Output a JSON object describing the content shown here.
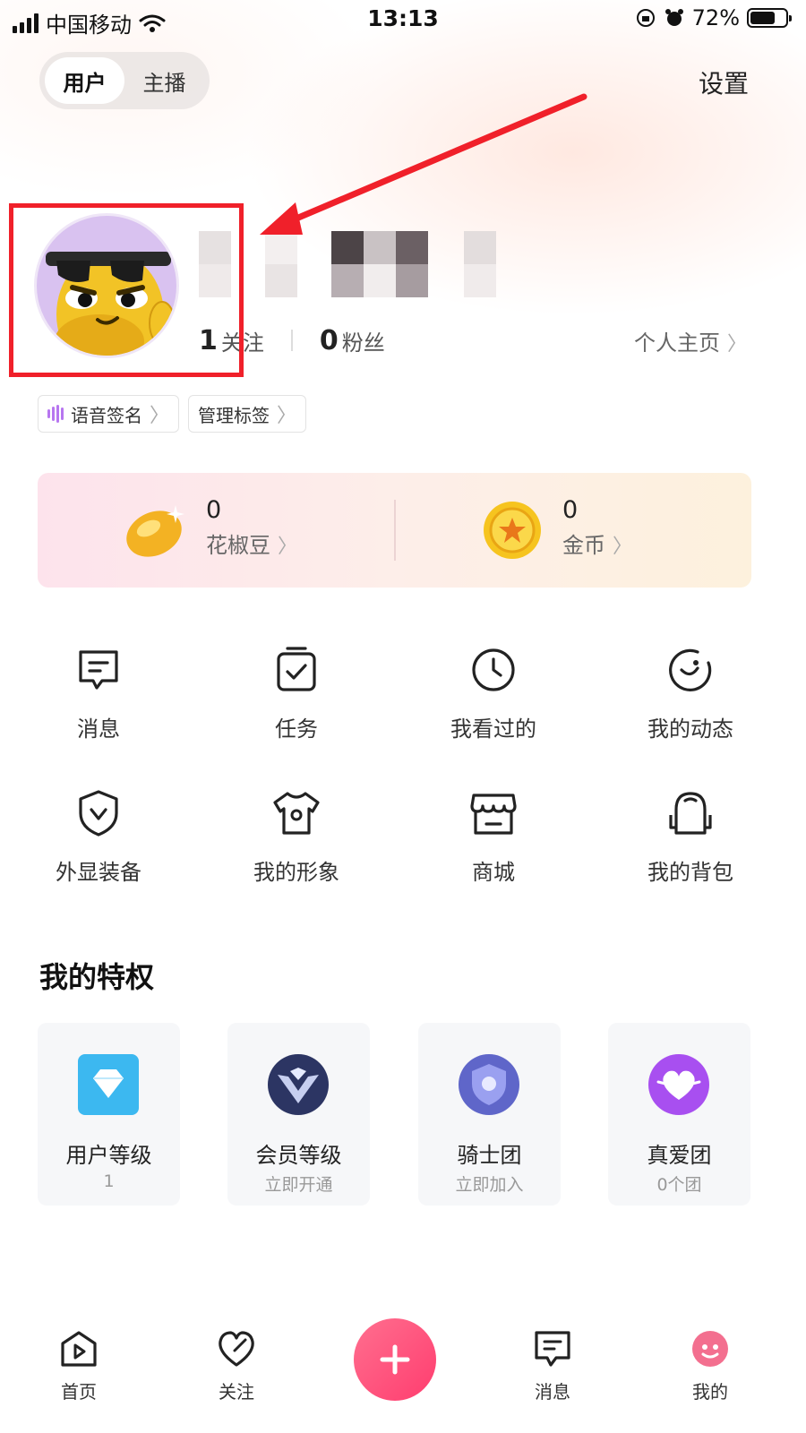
{
  "status_bar": {
    "carrier": "中国移动",
    "time": "13:13",
    "battery": "72%",
    "battery_level": 0.72
  },
  "header": {
    "tabs": [
      {
        "label": "用户",
        "active": true
      },
      {
        "label": "主播",
        "active": false
      }
    ],
    "settings_label": "设置"
  },
  "profile": {
    "following_count": "1",
    "following_label": "关注",
    "followers_count": "0",
    "followers_label": "粉丝",
    "homepage_label": "个人主页"
  },
  "tags": [
    {
      "label": "语音签名"
    },
    {
      "label": "管理标签"
    }
  ],
  "wallet": {
    "beans": {
      "value": "0",
      "label": "花椒豆"
    },
    "coins": {
      "value": "0",
      "label": "金币"
    }
  },
  "menu": [
    {
      "label": "消息",
      "icon": "message-icon"
    },
    {
      "label": "任务",
      "icon": "task-icon"
    },
    {
      "label": "我看过的",
      "icon": "history-clock-icon"
    },
    {
      "label": "我的动态",
      "icon": "moments-icon"
    },
    {
      "label": "外显装备",
      "icon": "shield-icon"
    },
    {
      "label": "我的形象",
      "icon": "tshirt-icon"
    },
    {
      "label": "商城",
      "icon": "store-icon"
    },
    {
      "label": "我的背包",
      "icon": "backpack-icon"
    }
  ],
  "privileges": {
    "title": "我的特权",
    "items": [
      {
        "title": "用户等级",
        "sub": "1",
        "icon": "diamond-icon"
      },
      {
        "title": "会员等级",
        "sub": "立即开通",
        "icon": "vip-badge-icon"
      },
      {
        "title": "骑士团",
        "sub": "立即加入",
        "icon": "knight-shield-icon"
      },
      {
        "title": "真爱团",
        "sub": "0个团",
        "icon": "heart-badge-icon"
      }
    ]
  },
  "tabbar": {
    "items": [
      {
        "label": "首页",
        "icon": "home-play-icon"
      },
      {
        "label": "关注",
        "icon": "heart-icon"
      },
      {
        "label": "",
        "icon": "plus-icon"
      },
      {
        "label": "消息",
        "icon": "message-icon"
      },
      {
        "label": "我的",
        "icon": "avatar-icon"
      }
    ]
  },
  "colors": {
    "accent": "#ff3d6f",
    "annotation": "#f0202a",
    "avatar_bg": "#d9c2f0"
  }
}
